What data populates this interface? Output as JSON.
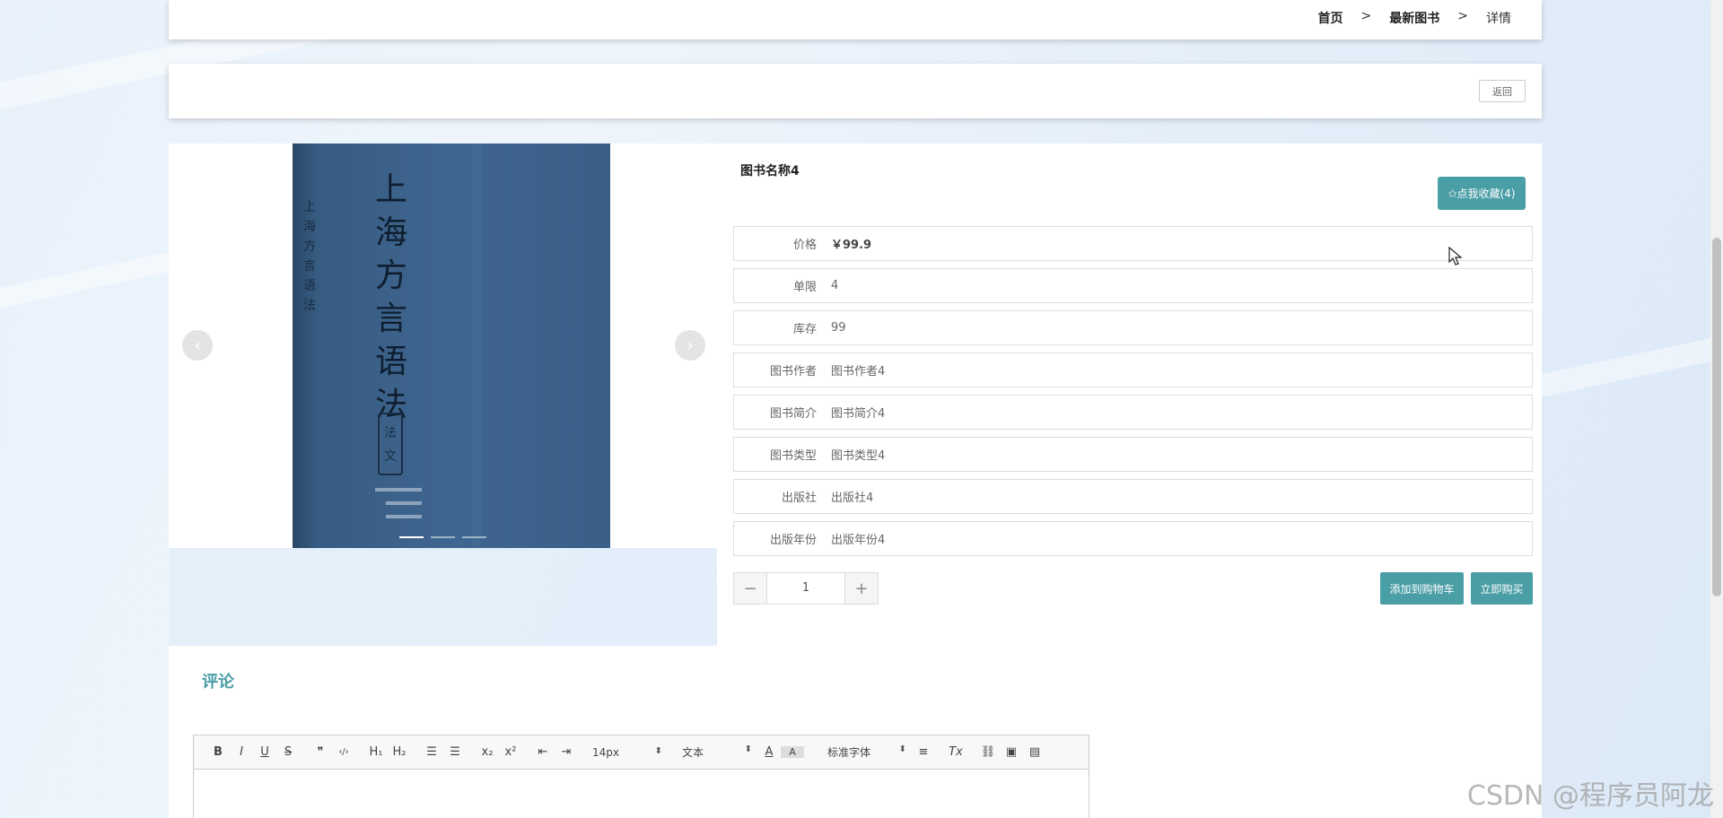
{
  "breadcrumb": {
    "home": "首页",
    "sep1": ">",
    "latest": "最新图书",
    "sep2": ">",
    "current": "详情"
  },
  "actions": {
    "back_label": "返回"
  },
  "carousel": {
    "prev_icon": "chevron-left-icon",
    "next_icon": "chevron-right-icon",
    "cover": {
      "title_chars": [
        "上",
        "海",
        "方",
        "言",
        "语",
        "法"
      ],
      "spine_chars": [
        "上",
        "海",
        "方",
        "言",
        "语",
        "法"
      ],
      "label": "法文"
    },
    "slide_count": 3,
    "active_slide": 1
  },
  "book": {
    "name": "图书名称4",
    "favorite_label": "✩点我收藏(4)",
    "fields": [
      {
        "key": "价格",
        "value": "￥99.9"
      },
      {
        "key": "单限",
        "value": "4"
      },
      {
        "key": "库存",
        "value": "99"
      },
      {
        "key": "图书作者",
        "value": "图书作者4"
      },
      {
        "key": "图书简介",
        "value": "图书简介4"
      },
      {
        "key": "图书类型",
        "value": "图书类型4"
      },
      {
        "key": "出版社",
        "value": "出版社4"
      },
      {
        "key": "出版年份",
        "value": "出版年份4"
      }
    ],
    "quantity": "1",
    "minus": "−",
    "plus": "+",
    "add_to_cart_label": "添加到购物车",
    "buy_now_label": "立即购买"
  },
  "comments": {
    "title": "评论",
    "toolbar": {
      "bold": "B",
      "italic": "I",
      "underline": "U",
      "strike": "S",
      "quote": "❞",
      "code": "‹/›",
      "h1": "H₁",
      "h2": "H₂",
      "ol": "☰",
      "ul": "☰",
      "sub": "x₂",
      "sup": "x²",
      "outdent": "⇤",
      "indent": "⇥",
      "size": "14px",
      "header": "文本",
      "color": "A",
      "bg": "A",
      "font": "标准字体",
      "align": "≡",
      "clean": "Tx",
      "link": "⛓",
      "image": "▣",
      "video": "▤"
    }
  },
  "watermark": "CSDN @程序员阿龙",
  "colors": {
    "accent": "#4a9ea5",
    "background": "#e8f1fb"
  }
}
